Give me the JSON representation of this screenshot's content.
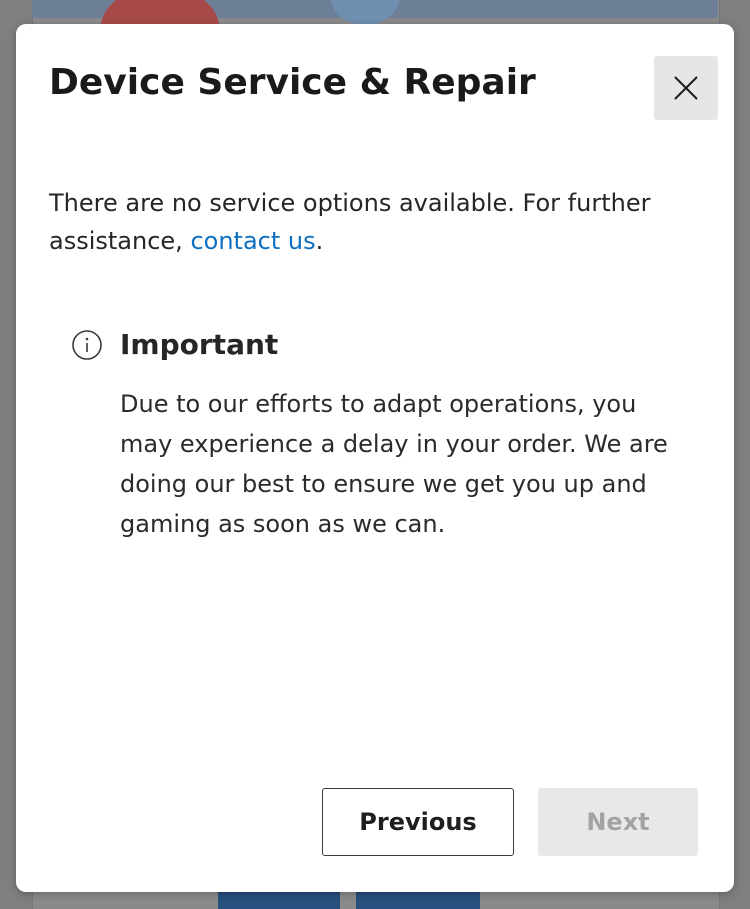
{
  "dialog": {
    "title": "Device Service & Repair",
    "close_icon": "close-icon",
    "message_text": "There are no service options available. For further assistance, ",
    "contact_link": "contact us",
    "message_end": ".",
    "notice": {
      "icon": "info-icon",
      "title": "Important",
      "body": "Due to our efforts to adapt operations, you may experience a delay in your order. We are doing our best to ensure we get you up and gaming as soon as we can."
    },
    "buttons": {
      "previous_label": "Previous",
      "next_label": "Next",
      "next_disabled": true
    }
  },
  "colors": {
    "link": "#0e6fc0",
    "overlay": "#7f7f7f",
    "close_bg": "#e6e6e6",
    "disabled_bg": "#e8e8e8",
    "disabled_text": "#a3a3a3"
  }
}
